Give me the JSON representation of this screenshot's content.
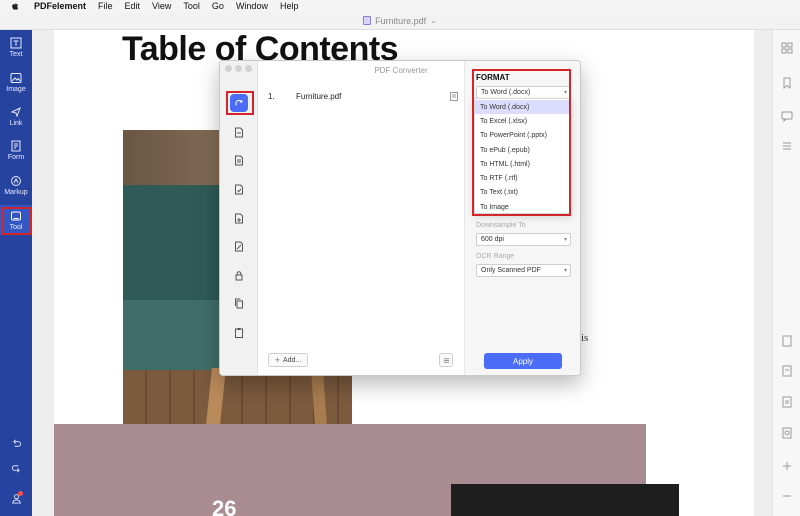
{
  "menubar": {
    "app_name": "PDFelement",
    "items": [
      "File",
      "Edit",
      "View",
      "Tool",
      "Go",
      "Window",
      "Help"
    ]
  },
  "window": {
    "title": "Furniture.pdf"
  },
  "sidebar": {
    "items": [
      {
        "label": "Text",
        "icon": "text-icon"
      },
      {
        "label": "Image",
        "icon": "image-icon"
      },
      {
        "label": "Link",
        "icon": "link-icon"
      },
      {
        "label": "Form",
        "icon": "form-icon"
      },
      {
        "label": "Markup",
        "icon": "markup-icon"
      },
      {
        "label": "Tool",
        "icon": "tool-icon",
        "active": true
      }
    ]
  },
  "document": {
    "title": "Table of Contents",
    "page_number": "26",
    "partial_text": "is"
  },
  "converter": {
    "title": "PDF Converter",
    "files": [
      {
        "index": "1.",
        "name": "Furniture.pdf"
      }
    ],
    "add_label": "Add...",
    "format_label": "FORMAT",
    "format_selected": "To Word (.docx)",
    "format_options": [
      "To Word (.docx)",
      "To Excel (.xlsx)",
      "To PowerPoint (.pptx)",
      "To ePub (.epub)",
      "To HTML (.html)",
      "To RTF (.rtf)",
      "To Text (.txt)",
      "To Image"
    ],
    "downsample_label": "Downsample To",
    "downsample_value": "600 dpi",
    "ocr_label": "OCR Range",
    "ocr_value": "Only Scanned PDF",
    "apply_label": "Apply"
  },
  "colors": {
    "sidebar": "#2743a0",
    "accent": "#4a6cf7",
    "highlight": "#d3262b"
  }
}
